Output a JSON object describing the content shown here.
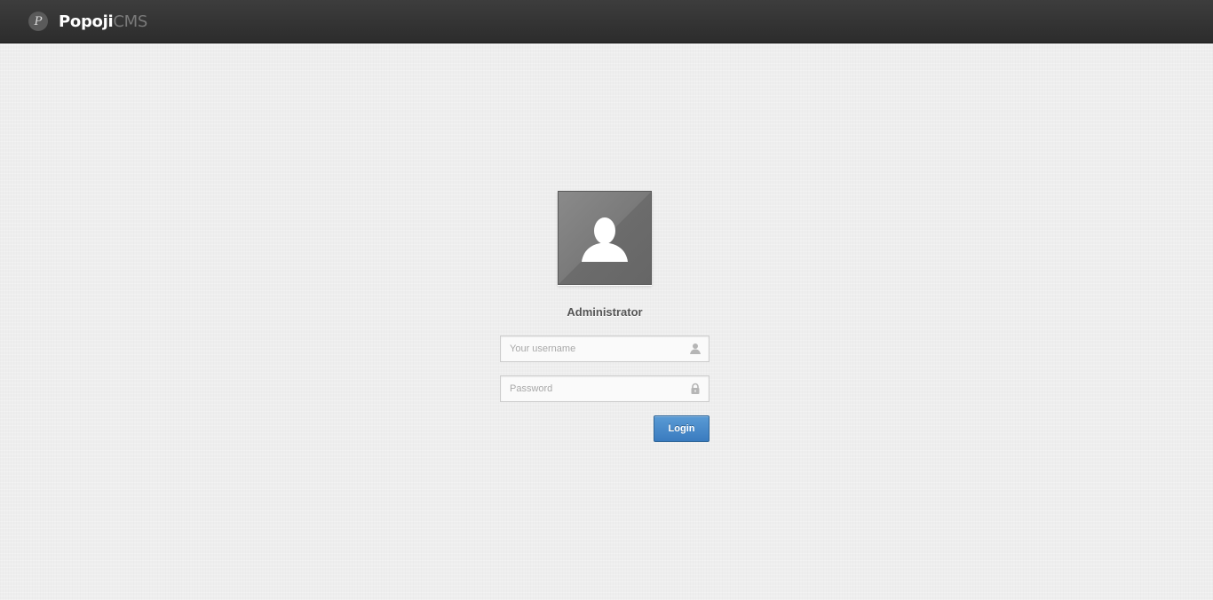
{
  "brand": {
    "logo_glyph": "P",
    "name_main": "Popoji",
    "name_suffix": "CMS"
  },
  "login": {
    "role_label": "Administrator",
    "username_placeholder": "Your username",
    "password_placeholder": "Password",
    "submit_label": "Login"
  },
  "icons": {
    "logo": "popoji-logo-icon",
    "avatar": "user-silhouette-icon",
    "username": "user-icon",
    "password": "lock-icon"
  },
  "colors": {
    "topbar": "#333333",
    "background": "#eeeeee",
    "button": "#4a8bc9"
  }
}
